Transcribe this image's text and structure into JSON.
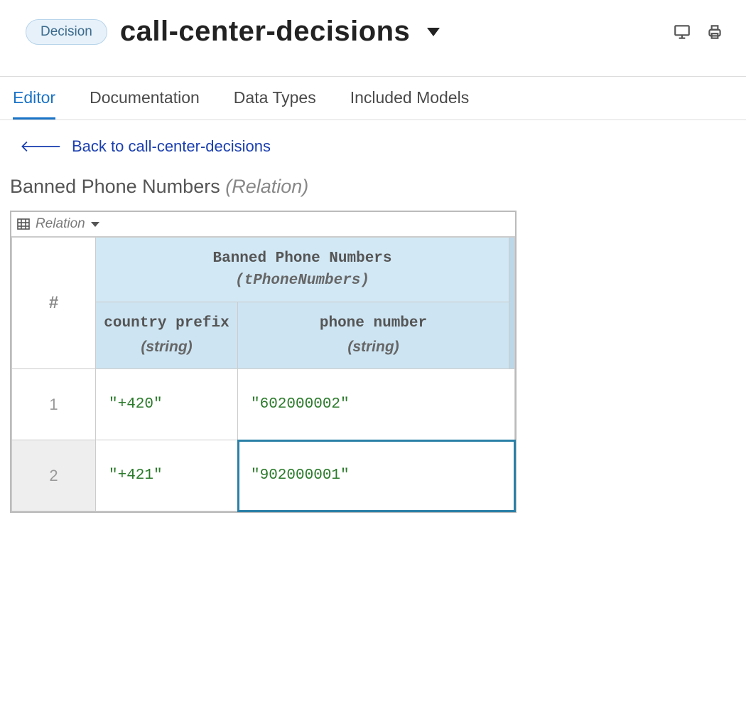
{
  "header": {
    "badge": "Decision",
    "title": "call-center-decisions"
  },
  "tabs": [
    {
      "label": "Editor",
      "active": true
    },
    {
      "label": "Documentation",
      "active": false
    },
    {
      "label": "Data Types",
      "active": false
    },
    {
      "label": "Included Models",
      "active": false
    }
  ],
  "back": {
    "label": "Back to call-center-decisions"
  },
  "node": {
    "name": "Banned Phone Numbers",
    "kind": "(Relation)"
  },
  "relation": {
    "dropdownLabel": "Relation",
    "group": {
      "title": "Banned Phone Numbers",
      "type": "(tPhoneNumbers)"
    },
    "columns": [
      {
        "name": "country prefix",
        "type": "(string)"
      },
      {
        "name": "phone number",
        "type": "(string)"
      }
    ],
    "hashSymbol": "#",
    "rows": [
      {
        "index": "1",
        "prefix": "\"+420\"",
        "phone": "\"602000002\"",
        "activeIndex": false,
        "phoneSelected": false
      },
      {
        "index": "2",
        "prefix": "\"+421\"",
        "phone": "\"902000001\"",
        "activeIndex": true,
        "phoneSelected": true
      }
    ]
  }
}
